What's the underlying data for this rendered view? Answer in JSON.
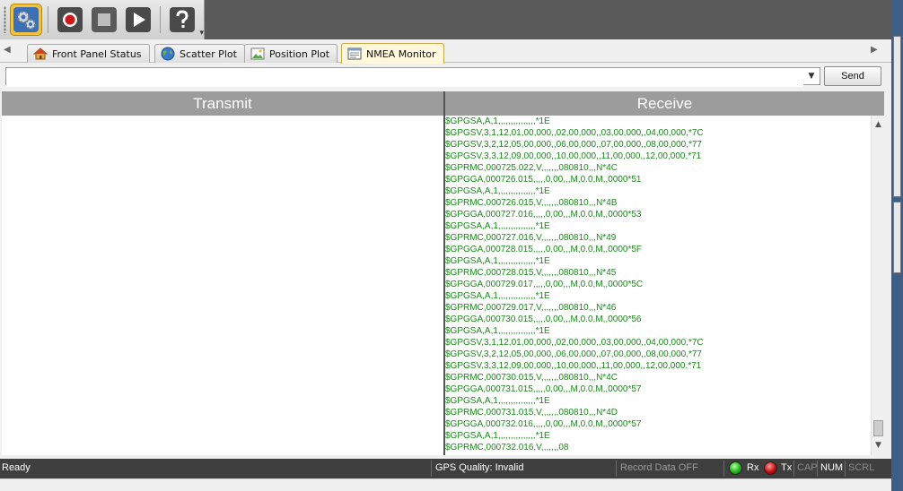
{
  "toolbar": {
    "dropdown_glyph": "▾",
    "icons": [
      "settings-gears-icon",
      "record-icon",
      "stop-icon",
      "play-icon",
      "help-icon"
    ]
  },
  "tabs": [
    {
      "label": "Front Panel Status",
      "icon": "home-icon"
    },
    {
      "label": "Scatter Plot",
      "icon": "globe-icon"
    },
    {
      "label": "Position Plot",
      "icon": "image-icon"
    },
    {
      "label": "NMEA Monitor",
      "icon": "document-icon",
      "active": true
    }
  ],
  "command": {
    "value": "",
    "send_label": "Send"
  },
  "transmit": {
    "header": "Transmit"
  },
  "receive": {
    "header": "Receive",
    "lines": [
      "$GPGSA,A,1,,,,,,,,,,,,,,,*1E",
      "$GPGSV,3,1,12,01,00,000,,02,00,000,,03,00,000,,04,00,000,*7C",
      "$GPGSV,3,2,12,05,00,000,,06,00,000,,07,00,000,,08,00,000,*77",
      "$GPGSV,3,3,12,09,00,000,,10,00,000,,11,00,000,,12,00,000,*71",
      "$GPRMC,000725.022,V,,,,,,,080810,,,N*4C",
      "$GPGGA,000726.015,,,,,0,00,,,M,0.0,M,,0000*51",
      "$GPGSA,A,1,,,,,,,,,,,,,,,*1E",
      "$GPRMC,000726.015,V,,,,,,,080810,,,N*4B",
      "$GPGGA,000727.016,,,,,0,00,,,M,0.0,M,,0000*53",
      "$GPGSA,A,1,,,,,,,,,,,,,,,*1E",
      "$GPRMC,000727.016,V,,,,,,,080810,,,N*49",
      "$GPGGA,000728.015,,,,,0,00,,,M,0.0,M,,0000*5F",
      "$GPGSA,A,1,,,,,,,,,,,,,,,*1E",
      "$GPRMC,000728.015,V,,,,,,,080810,,,N*45",
      "$GPGGA,000729.017,,,,,0,00,,,M,0.0,M,,0000*5C",
      "$GPGSA,A,1,,,,,,,,,,,,,,,*1E",
      "$GPRMC,000729.017,V,,,,,,,080810,,,N*46",
      "$GPGGA,000730.015,,,,,0,00,,,M,0.0,M,,0000*56",
      "$GPGSA,A,1,,,,,,,,,,,,,,,*1E",
      "$GPGSV,3,1,12,01,00,000,,02,00,000,,03,00,000,,04,00,000,*7C",
      "$GPGSV,3,2,12,05,00,000,,06,00,000,,07,00,000,,08,00,000,*77",
      "$GPGSV,3,3,12,09,00,000,,10,00,000,,11,00,000,,12,00,000,*71",
      "$GPRMC,000730.015,V,,,,,,,080810,,,N*4C",
      "$GPGGA,000731.015,,,,,0,00,,,M,0.0,M,,0000*57",
      "$GPGSA,A,1,,,,,,,,,,,,,,,*1E",
      "$GPRMC,000731.015,V,,,,,,,080810,,,N*4D",
      "$GPGGA,000732.016,,,,,0,00,,,M,0.0,M,,0000*57",
      "$GPGSA,A,1,,,,,,,,,,,,,,,*1E",
      "$GPRMC,000732.016,V,,,,,,,08"
    ]
  },
  "status": {
    "ready": "Ready",
    "gps_quality": "GPS Quality: Invalid",
    "record": "Record Data OFF",
    "rx_label": "Rx",
    "tx_label": "Tx",
    "indicators": [
      {
        "label": "CAP",
        "on": false
      },
      {
        "label": "NUM",
        "on": true
      },
      {
        "label": "SCRL",
        "on": false
      }
    ],
    "rx_led_color": "#1eb41e",
    "tx_led_color": "#c01010"
  },
  "colors": {
    "receive_text": "#1a8a1a",
    "header_bg": "#9c9c9c",
    "statusbar_bg": "#3f3f3f",
    "active_tab_bg": "#fff8dc",
    "toolbar_active": "#f3c23c"
  }
}
